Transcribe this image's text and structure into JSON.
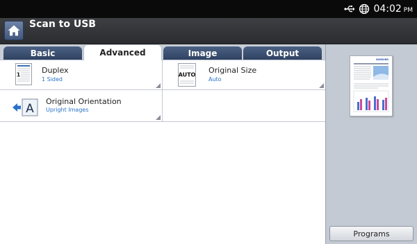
{
  "status_bar": {
    "time": "04:02",
    "ampm": "PM",
    "icons": [
      "usb-icon",
      "globe-icon"
    ]
  },
  "header": {
    "title": "Scan to USB",
    "home_icon": "home-icon"
  },
  "tabs": [
    {
      "label": "Basic",
      "active": false
    },
    {
      "label": "Advanced",
      "active": true
    },
    {
      "label": "Image",
      "active": false
    },
    {
      "label": "Output",
      "active": false
    }
  ],
  "options": {
    "duplex": {
      "label": "Duplex",
      "value": "1 Sided",
      "icon": "duplex-page-icon"
    },
    "original_size": {
      "label": "Original Size",
      "value": "Auto",
      "icon": "auto-size-icon",
      "icon_text": "AUTO"
    },
    "original_orientation": {
      "label": "Original Orientation",
      "value": "Upright Images",
      "icon": "orientation-icon",
      "icon_text": "A"
    }
  },
  "sidebar": {
    "programs_label": "Programs",
    "preview_logo": "SAMSUNG"
  },
  "colors": {
    "status_bar": "#0a0a0a",
    "title_bar": "#2f3135",
    "tab_inactive": "#3c5173",
    "value_text": "#2a72c8",
    "sidebar": "#c4cad3"
  }
}
